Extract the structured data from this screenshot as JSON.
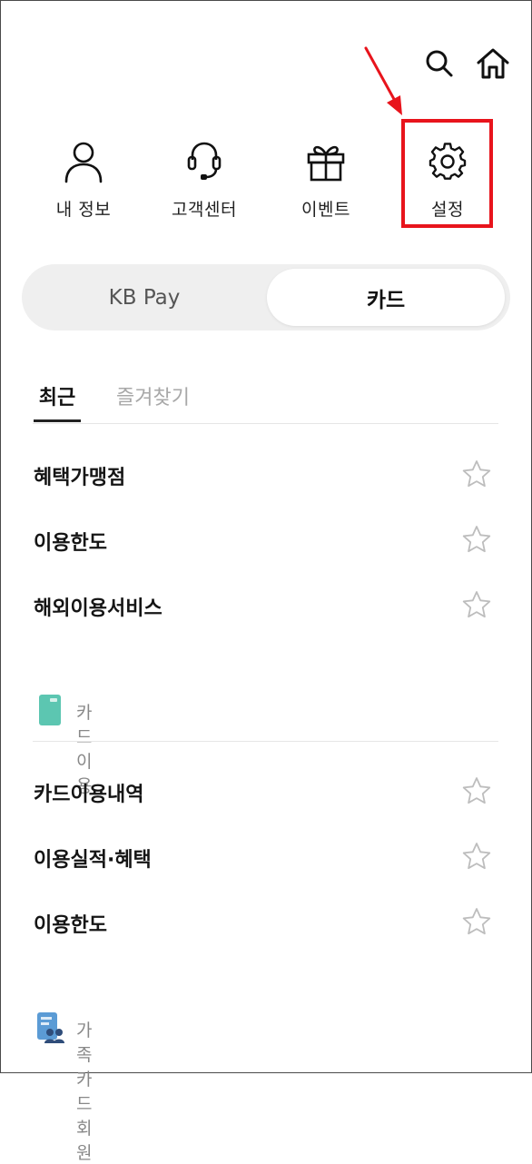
{
  "header": {
    "search_icon": "search-icon",
    "home_icon": "home-icon"
  },
  "quick_menu": [
    {
      "label": "내 정보",
      "icon": "person-icon"
    },
    {
      "label": "고객센터",
      "icon": "headset-icon"
    },
    {
      "label": "이벤트",
      "icon": "gift-icon"
    },
    {
      "label": "설정",
      "icon": "gear-icon"
    }
  ],
  "annotation": {
    "highlight_color": "#e8141c",
    "target": "설정"
  },
  "segment": {
    "options": [
      "KB Pay",
      "카드"
    ],
    "selected": "카드"
  },
  "tabs": {
    "items": [
      "최근",
      "즐겨찾기"
    ],
    "selected": "최근"
  },
  "recent_items": [
    {
      "label": "혜택가맹점"
    },
    {
      "label": "이용한도"
    },
    {
      "label": "해외이용서비스"
    }
  ],
  "sections": [
    {
      "title": "카드이용",
      "icon": "card-icon",
      "color": "#5cc6b1",
      "items": [
        {
          "label": "카드이용내역"
        },
        {
          "label": "이용실적·혜택"
        },
        {
          "label": "이용한도"
        }
      ]
    },
    {
      "title": "가족카드회원",
      "icon": "family-card-icon",
      "color": "#5b9bd5"
    }
  ]
}
